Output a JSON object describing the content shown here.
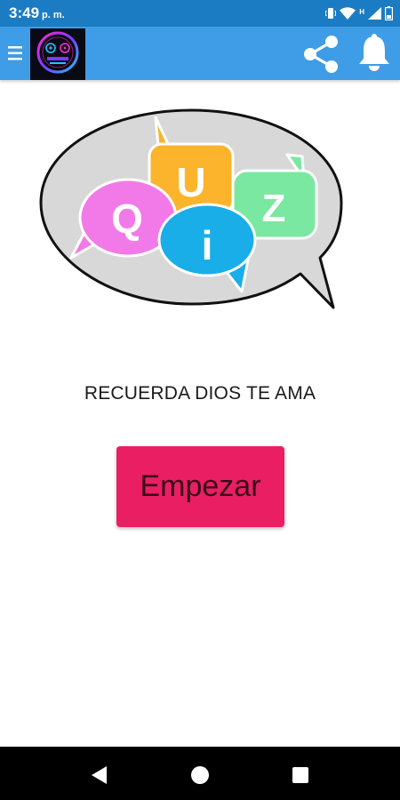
{
  "status_bar": {
    "time": "3:49",
    "ampm": "p. m.",
    "network_label": "H",
    "icons": [
      "vibrate-icon",
      "wifi-icon",
      "signal-icon",
      "battery-icon"
    ]
  },
  "app_bar": {
    "background": "#3e9de6",
    "icons": [
      "menu-icon",
      "app-logo",
      "share-icon",
      "bell-icon"
    ]
  },
  "quiz_logo": {
    "letters": [
      "Q",
      "U",
      "i",
      "Z"
    ],
    "colors": {
      "q": "#f27ae8",
      "u": "#fbb42b",
      "i": "#19aee8",
      "z": "#7ae8a0",
      "bubble": "#d8d8d8"
    }
  },
  "main": {
    "tagline": "RECUERDA DIOS TE AMA",
    "start_button_label": "Empezar",
    "start_button_color": "#e91e63"
  },
  "nav_bar": {
    "icons": [
      "back-icon",
      "home-icon",
      "recents-icon"
    ]
  }
}
